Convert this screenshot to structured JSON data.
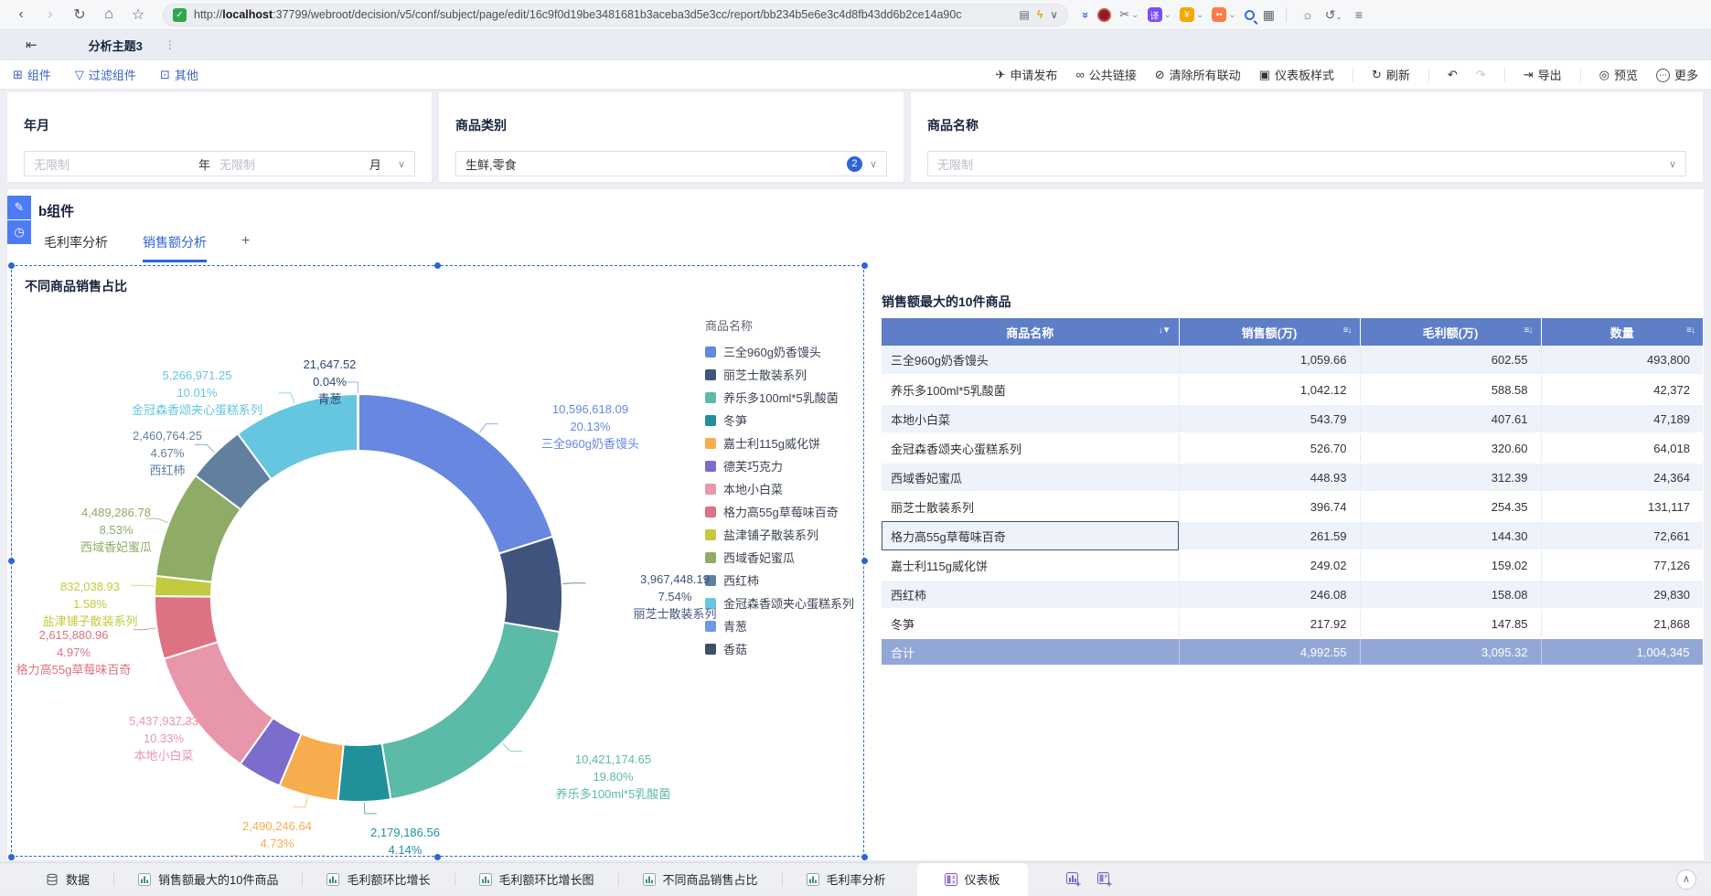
{
  "browser": {
    "url_scheme": "http://",
    "url_host": "localhost",
    "url_rest": ":37799/webroot/decision/v5/conf/subject/page/edit/16c9f0d19be3481681b3aceba3d5e3cc/report/bb234b5e6e3c4d8fb43dd6b2ce14a90c"
  },
  "app_tab": {
    "title": "分析主题3"
  },
  "toolbar": {
    "left": [
      {
        "icon": "component",
        "label": "组件"
      },
      {
        "icon": "filter",
        "label": "过滤组件"
      },
      {
        "icon": "other",
        "label": "其他"
      }
    ],
    "right": [
      {
        "icon": "send",
        "label": "申请发布"
      },
      {
        "icon": "link",
        "label": "公共链接"
      },
      {
        "icon": "unlink",
        "label": "清除所有联动"
      },
      {
        "icon": "style",
        "label": "仪表板样式"
      },
      {
        "sep": true
      },
      {
        "icon": "refresh",
        "label": "刷新"
      },
      {
        "sep": true
      },
      {
        "icon": "undo",
        "label": ""
      },
      {
        "icon": "redo",
        "label": "",
        "disabled": true
      },
      {
        "sep": true
      },
      {
        "icon": "export",
        "label": "导出"
      },
      {
        "sep": true
      },
      {
        "icon": "preview",
        "label": "预览"
      },
      {
        "icon": "more",
        "label": "更多"
      }
    ]
  },
  "filters": {
    "year_month": {
      "title": "年月",
      "year_placeholder": "无限制",
      "year_unit": "年",
      "month_placeholder": "无限制",
      "month_unit": "月"
    },
    "category": {
      "title": "商品类别",
      "value": "生鲜,零食",
      "badge": "2"
    },
    "product": {
      "title": "商品名称",
      "placeholder": "无限制"
    }
  },
  "component": {
    "title": "b组件",
    "tabs": [
      "毛利率分析",
      "销售额分析"
    ],
    "active_tab": "销售额分析",
    "add_tab_label": "+"
  },
  "chart_data": {
    "type": "donut",
    "title": "不同商品销售占比",
    "legend_title": "商品名称",
    "legend_position": "right",
    "slices": [
      {
        "name": "三全960g奶香馒头",
        "pct": 20.13,
        "color": "#6787E0"
      },
      {
        "name": "丽芝士散装系列",
        "pct": 7.54,
        "color": "#41547D"
      },
      {
        "name": "养乐多100ml*5乳酸菌",
        "pct": 19.8,
        "color": "#5CBAA8"
      },
      {
        "name": "冬笋",
        "pct": 4.14,
        "color": "#20909B"
      },
      {
        "name": "嘉士利115g威化饼",
        "pct": 4.73,
        "color": "#F7AC4D"
      },
      {
        "name": "德芙巧克力",
        "pct": 3.5,
        "color": "#7C6CCB"
      },
      {
        "name": "本地小白菜",
        "pct": 10.33,
        "color": "#E897AA"
      },
      {
        "name": "格力高55g草莓味百奇",
        "pct": 4.97,
        "color": "#DD7283"
      },
      {
        "name": "盐津铺子散装系列",
        "pct": 1.58,
        "color": "#C1CB3D"
      },
      {
        "name": "西域香妃蜜瓜",
        "pct": 8.53,
        "color": "#8EAC65"
      },
      {
        "name": "西红柿",
        "pct": 4.67,
        "color": "#61809F"
      },
      {
        "name": "金冠森香颂夹心蛋糕系列",
        "pct": 10.01,
        "color": "#66C6DF"
      },
      {
        "name": "青葱",
        "pct": 0.04,
        "color": "#6E97E6"
      },
      {
        "name": "香菇",
        "pct": 0.03,
        "color": "#3F4F68"
      }
    ],
    "labels": [
      {
        "name": "三全960g奶香馒头",
        "value": "10,596,618.09",
        "pct": "20.13%"
      },
      {
        "name": "丽芝士散装系列",
        "value": "3,967,448.19",
        "pct": "7.54%"
      },
      {
        "name": "养乐多100ml*5乳酸菌",
        "value": "10,421,174.65",
        "pct": "19.80%"
      },
      {
        "name": "冬笋",
        "value": "2,179,186.56",
        "pct": "4.14%"
      },
      {
        "name": "嘉士利115g威化饼",
        "value": "2,490,246.64",
        "pct": "4.73%"
      },
      {
        "name": "本地小白菜",
        "value": "5,437,937.33",
        "pct": "10.33%"
      },
      {
        "name": "格力高55g草莓味百奇",
        "value": "2,615,880.96",
        "pct": "4.97%"
      },
      {
        "name": "盐津铺子散装系列",
        "value": "832,038.93",
        "pct": "1.58%"
      },
      {
        "name": "西域香妃蜜瓜",
        "value": "4,489,286.78",
        "pct": "8.53%"
      },
      {
        "name": "西红柿",
        "value": "2,460,764.25",
        "pct": "4.67%"
      },
      {
        "name": "金冠森香颂夹心蛋糕系列",
        "value": "5,266,971.25",
        "pct": "10.01%"
      },
      {
        "name": "青葱",
        "value": "21,647.52",
        "pct": "0.04%"
      }
    ]
  },
  "table": {
    "title": "销售额最大的10件商品",
    "columns": [
      "商品名称",
      "销售额(万)",
      "毛利额(万)",
      "数量"
    ],
    "rows": [
      [
        "三全960g奶香馒头",
        "1,059.66",
        "602.55",
        "493,800"
      ],
      [
        "养乐多100ml*5乳酸菌",
        "1,042.12",
        "588.58",
        "42,372"
      ],
      [
        "本地小白菜",
        "543.79",
        "407.61",
        "47,189"
      ],
      [
        "金冠森香颂夹心蛋糕系列",
        "526.70",
        "320.60",
        "64,018"
      ],
      [
        "西域香妃蜜瓜",
        "448.93",
        "312.39",
        "24,364"
      ],
      [
        "丽芝士散装系列",
        "396.74",
        "254.35",
        "131,117"
      ],
      [
        "格力高55g草莓味百奇",
        "261.59",
        "144.30",
        "72,661"
      ],
      [
        "嘉士利115g威化饼",
        "249.02",
        "159.02",
        "77,126"
      ],
      [
        "西红柿",
        "246.08",
        "158.08",
        "29,830"
      ],
      [
        "冬笋",
        "217.92",
        "147.85",
        "21,868"
      ]
    ],
    "selected_cell": {
      "row": 6,
      "col": 0
    },
    "total": {
      "label": "合计",
      "values": [
        "4,992.55",
        "3,095.32",
        "1,004,345"
      ]
    }
  },
  "bottom_bar": {
    "items": [
      {
        "icon": "database",
        "label": "数据"
      },
      {
        "icon": "chart",
        "label": "销售额最大的10件商品"
      },
      {
        "icon": "chart",
        "label": "毛利额环比增长"
      },
      {
        "icon": "chart",
        "label": "毛利额环比增长图"
      },
      {
        "icon": "chart",
        "label": "不同商品销售占比"
      },
      {
        "icon": "chart",
        "label": "毛利率分析"
      },
      {
        "icon": "dashboard",
        "label": "仪表板",
        "active": true
      }
    ],
    "trailing_icons": [
      "add-chart-icon",
      "add-dashboard-icon"
    ]
  },
  "colors": {
    "accent_blue": "#2e64d8",
    "table_header": "#5e7ec8",
    "table_total": "#93a7d7"
  }
}
